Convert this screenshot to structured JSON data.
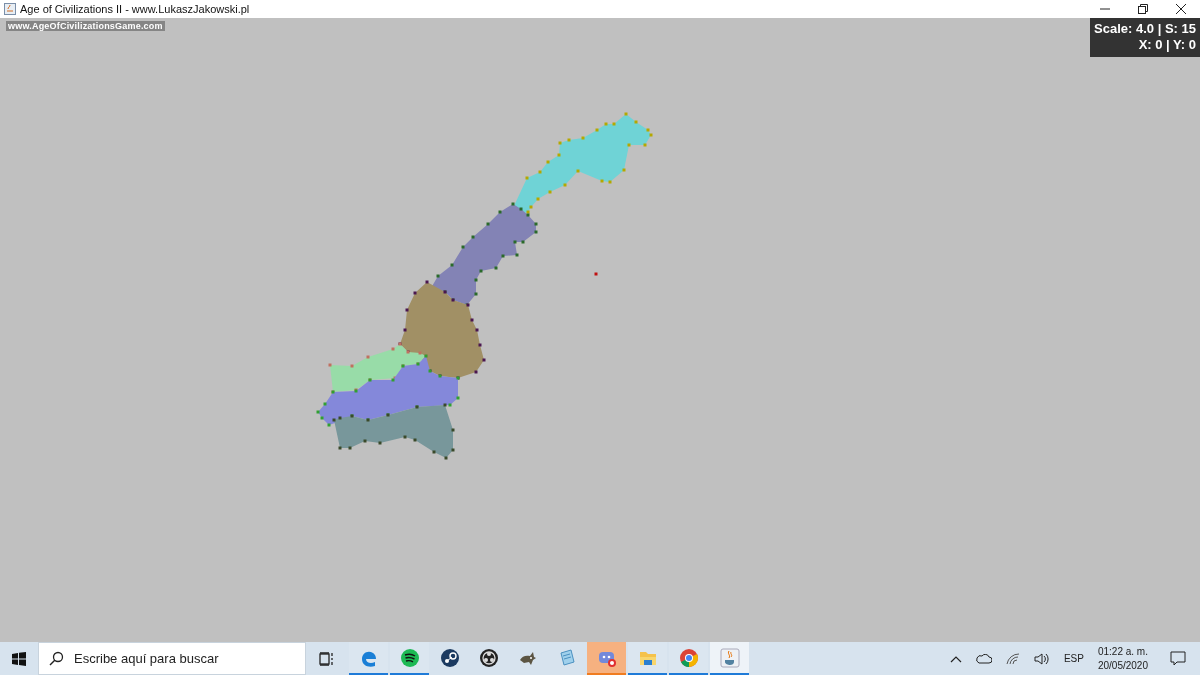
{
  "window": {
    "title": "Age of Civilizations II - www.LukaszJakowski.pl"
  },
  "canvas": {
    "watermark_text": "www.AgeOfCivilizationsGame.com",
    "info_lines": [
      "Scale: 4.0 | S: 15",
      "X: 0 | Y: 0"
    ]
  },
  "taskbar": {
    "search": {
      "placeholder": "Escribe aquí para buscar"
    },
    "apps": [
      {
        "kind": "edge",
        "running": true,
        "selected": false,
        "flashing": false
      },
      {
        "kind": "spotify",
        "running": true,
        "selected": false,
        "flashing": false
      },
      {
        "kind": "steam",
        "running": false,
        "selected": false,
        "flashing": false
      },
      {
        "kind": "obs",
        "running": false,
        "selected": false,
        "flashing": false
      },
      {
        "kind": "gimp",
        "running": false,
        "selected": false,
        "flashing": false
      },
      {
        "kind": "notepad",
        "running": false,
        "selected": false,
        "flashing": false
      },
      {
        "kind": "discord",
        "running": true,
        "selected": false,
        "flashing": true
      },
      {
        "kind": "folder",
        "running": true,
        "selected": false,
        "flashing": false
      },
      {
        "kind": "chrome",
        "running": true,
        "selected": false,
        "flashing": false
      },
      {
        "kind": "java",
        "running": true,
        "selected": true,
        "flashing": false
      }
    ],
    "language": "ESP",
    "time": "01:22 a. m.",
    "date": "20/05/2020"
  }
}
